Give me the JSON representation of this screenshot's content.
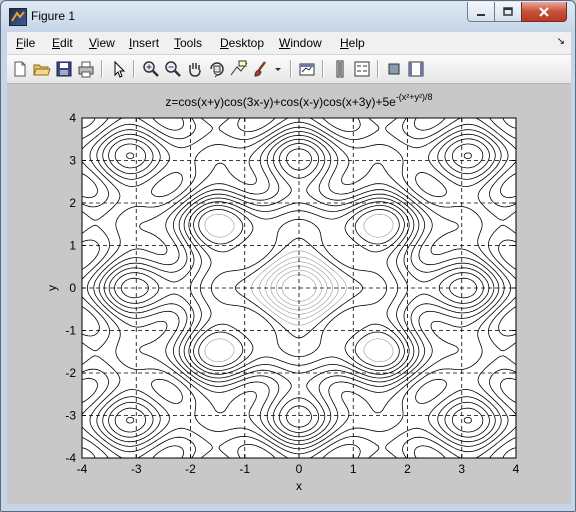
{
  "window": {
    "title": "Figure 1"
  },
  "menubar": {
    "items": [
      "File",
      "Edit",
      "View",
      "Insert",
      "Tools",
      "Desktop",
      "Window",
      "Help"
    ]
  },
  "toolbar": {
    "icons": [
      "new-figure-icon",
      "open-file-icon",
      "save-icon",
      "print-icon",
      "edit-plot-arrow-icon",
      "zoom-in-icon",
      "zoom-out-icon",
      "pan-hand-icon",
      "rotate-3d-icon",
      "data-cursor-icon",
      "brush-icon",
      "brush-dropdown-icon",
      "link-plot-icon",
      "colorbar-icon",
      "legend-icon",
      "hide-plot-tools-icon",
      "show-plot-tools-icon"
    ]
  },
  "colors": {
    "titlebar": "#c6d6e8",
    "figure_bg": "#c8c8c8",
    "axes_bg": "#ffffff",
    "contour": "#000000",
    "close_button": "#c7503a"
  },
  "chart_data": {
    "type": "contour",
    "title": "z=cos(x+y)cos(3x-y)+cos(x-y)cos(x+3y)+5e",
    "title_exponent": "-(x²+y²)/8",
    "xlabel": "x",
    "ylabel": "y",
    "xlim": [
      -4,
      4
    ],
    "ylim": [
      -4,
      4
    ],
    "xticks": [
      -4,
      -3,
      -2,
      -1,
      0,
      1,
      2,
      3,
      4
    ],
    "yticks": [
      -4,
      -3,
      -2,
      -1,
      0,
      1,
      2,
      3,
      4
    ],
    "grid": "dashed",
    "contour_levels": [
      -1.6,
      -1.2,
      -0.8,
      -0.4,
      0,
      0.4,
      0.8,
      1.2,
      1.6,
      2.0,
      2.4,
      2.8,
      3.2,
      3.6,
      4.0,
      4.4,
      4.8,
      5.2,
      5.6,
      6.0,
      6.4
    ]
  }
}
